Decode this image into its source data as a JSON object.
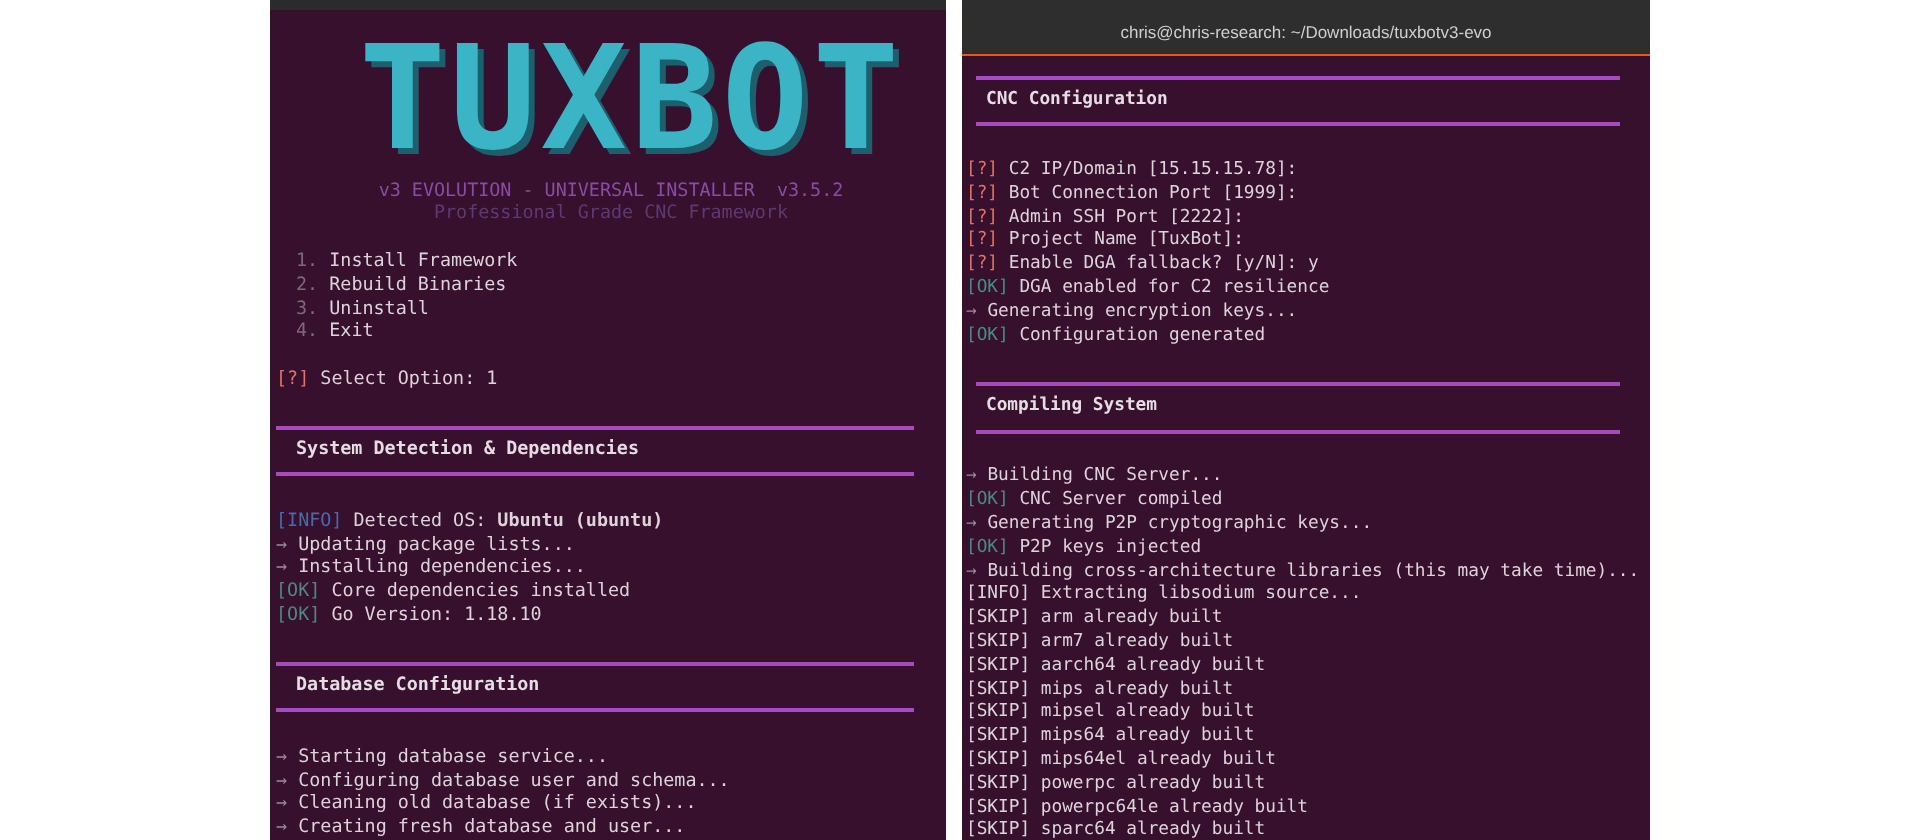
{
  "left_terminal": {
    "logo": "TUXBOT",
    "version": "v3 EVOLUTION - UNIVERSAL INSTALLER  v3.5.2",
    "tagline": "Professional Grade CNC Framework",
    "menu": [
      {
        "number": "1.",
        "label": "Install Framework"
      },
      {
        "number": "2.",
        "label": "Rebuild Binaries"
      },
      {
        "number": "3.",
        "label": "Uninstall"
      },
      {
        "number": "4.",
        "label": "Exit"
      }
    ],
    "blocks": [
      {
        "kind": "prompt",
        "tag": "[?]",
        "text": "Select Option: 1"
      },
      {
        "kind": "section",
        "text": "System Detection & Dependencies"
      },
      {
        "kind": "info",
        "tag": "[INFO]",
        "text": "Detected OS: **Ubuntu (ubuntu)**"
      },
      {
        "kind": "step",
        "tag": "→",
        "text": "Updating package lists..."
      },
      {
        "kind": "step",
        "tag": "→",
        "text": "Installing dependencies..."
      },
      {
        "kind": "ok",
        "tag": "[OK]",
        "text": "Core dependencies installed"
      },
      {
        "kind": "ok",
        "tag": "[OK]",
        "text": "Go Version: 1.18.10"
      },
      {
        "kind": "section",
        "text": "Database Configuration"
      },
      {
        "kind": "step",
        "tag": "→",
        "text": "Starting database service..."
      },
      {
        "kind": "step",
        "tag": "→",
        "text": "Configuring database user and schema..."
      },
      {
        "kind": "step",
        "tag": "→",
        "text": "Cleaning old database (if exists)..."
      },
      {
        "kind": "step",
        "tag": "→",
        "text": "Creating fresh database and user..."
      }
    ]
  },
  "right_terminal": {
    "title": "chris@chris-research: ~/Downloads/tuxbotv3-evo",
    "blocks": [
      {
        "kind": "section",
        "text": "CNC Configuration"
      },
      {
        "kind": "prompt",
        "tag": "[?]",
        "text": "C2 IP/Domain [15.15.15.78]:"
      },
      {
        "kind": "prompt",
        "tag": "[?]",
        "text": "Bot Connection Port [1999]:"
      },
      {
        "kind": "prompt",
        "tag": "[?]",
        "text": "Admin SSH Port [2222]:"
      },
      {
        "kind": "prompt",
        "tag": "[?]",
        "text": "Project Name [TuxBot]:"
      },
      {
        "kind": "prompt",
        "tag": "[?]",
        "text": "Enable DGA fallback? [y/N]: y"
      },
      {
        "kind": "ok",
        "tag": "[OK]",
        "text": "DGA enabled for C2 resilience"
      },
      {
        "kind": "step",
        "tag": "→",
        "text": "Generating encryption keys..."
      },
      {
        "kind": "ok",
        "tag": "[OK]",
        "text": "Configuration generated"
      },
      {
        "kind": "section",
        "text": "Compiling System"
      },
      {
        "kind": "step",
        "tag": "→",
        "text": "Building CNC Server..."
      },
      {
        "kind": "ok",
        "tag": "[OK]",
        "text": "CNC Server compiled"
      },
      {
        "kind": "step",
        "tag": "→",
        "text": "Generating P2P cryptographic keys..."
      },
      {
        "kind": "ok",
        "tag": "[OK]",
        "text": "P2P keys injected"
      },
      {
        "kind": "step",
        "tag": "→",
        "text": "Building cross-architecture libraries (this may take time)..."
      },
      {
        "kind": "plain",
        "text": "[INFO] Extracting libsodium source..."
      },
      {
        "kind": "plain",
        "text": "[SKIP] arm already built"
      },
      {
        "kind": "plain",
        "text": "[SKIP] arm7 already built"
      },
      {
        "kind": "plain",
        "text": "[SKIP] aarch64 already built"
      },
      {
        "kind": "plain",
        "text": "[SKIP] mips already built"
      },
      {
        "kind": "plain",
        "text": "[SKIP] mipsel already built"
      },
      {
        "kind": "plain",
        "text": "[SKIP] mips64 already built"
      },
      {
        "kind": "plain",
        "text": "[SKIP] mips64el already built"
      },
      {
        "kind": "plain",
        "text": "[SKIP] powerpc already built"
      },
      {
        "kind": "plain",
        "text": "[SKIP] powerpc64le already built"
      },
      {
        "kind": "plain",
        "text": "[SKIP] sparc64 already built"
      }
    ]
  }
}
